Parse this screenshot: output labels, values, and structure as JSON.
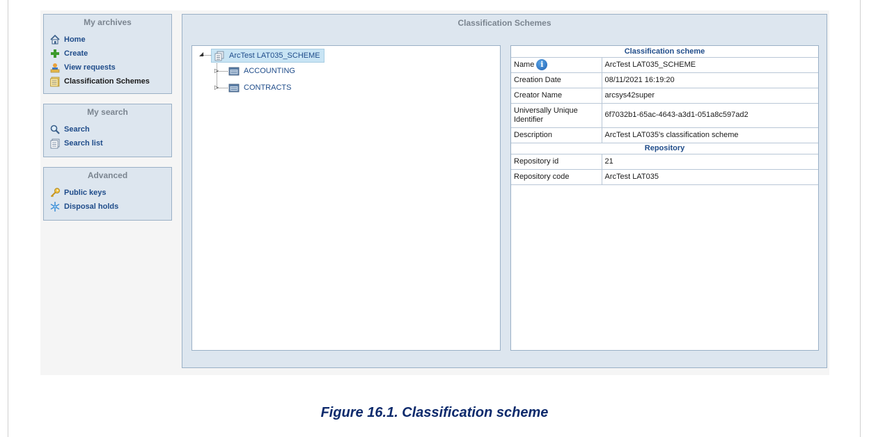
{
  "sidebar": {
    "my_archives": {
      "title": "My archives",
      "items": [
        {
          "label": "Home",
          "icon": "home-icon"
        },
        {
          "label": "Create",
          "icon": "plus-icon"
        },
        {
          "label": "View requests",
          "icon": "view-requests-icon"
        },
        {
          "label": "Classification Schemes",
          "icon": "classification-schemes-icon"
        }
      ]
    },
    "my_search": {
      "title": "My search",
      "items": [
        {
          "label": "Search",
          "icon": "magnifier-icon"
        },
        {
          "label": "Search list",
          "icon": "search-list-icon"
        }
      ]
    },
    "advanced": {
      "title": "Advanced",
      "items": [
        {
          "label": "Public keys",
          "icon": "key-icon"
        },
        {
          "label": "Disposal holds",
          "icon": "snowflake-icon"
        }
      ]
    }
  },
  "main": {
    "title": "Classification Schemes",
    "tree": {
      "root": "ArcTest LAT035_SCHEME",
      "children": [
        "ACCOUNTING",
        "CONTRACTS"
      ]
    },
    "details": {
      "section1": "Classification scheme",
      "name_label": "Name",
      "name_value": "ArcTest LAT035_SCHEME",
      "creation_date_label": "Creation Date",
      "creation_date_value": "08/11/2021 16:19:20",
      "creator_name_label": "Creator Name",
      "creator_name_value": "arcsys42super",
      "uuid_label": "Universally Unique Identifier",
      "uuid_value": "6f7032b1-65ac-4643-a3d1-051a8c597ad2",
      "description_label": "Description",
      "description_value": "ArcTest LAT035's classification scheme",
      "section2": "Repository",
      "repository_id_label": "Repository id",
      "repository_id_value": "21",
      "repository_code_label": "Repository code",
      "repository_code_value": "ArcTest LAT035"
    }
  },
  "caption": "Figure 16.1. Classification scheme"
}
